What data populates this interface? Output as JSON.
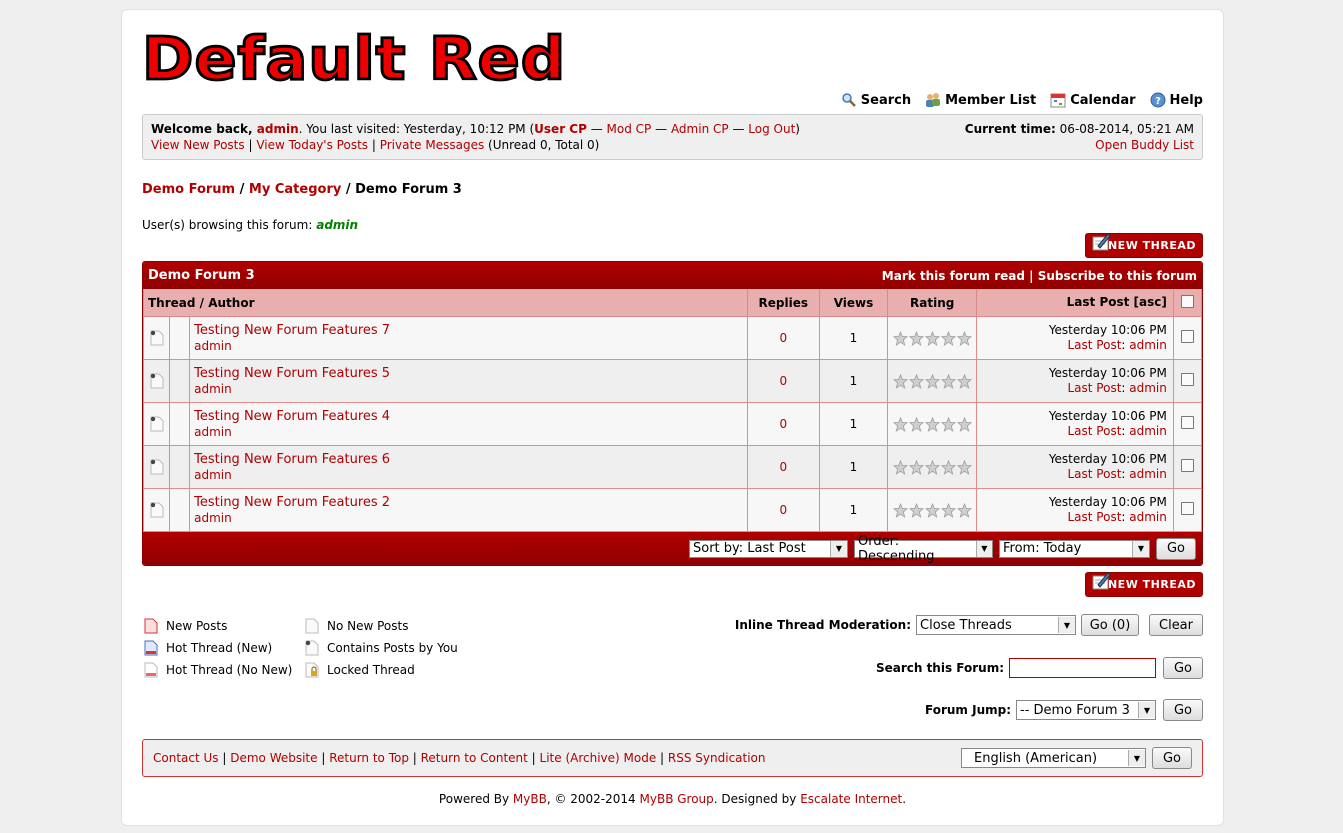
{
  "logo": {
    "text": "Default Red"
  },
  "menu": [
    {
      "label": "Search",
      "icon": "search-icon"
    },
    {
      "label": "Member List",
      "icon": "members-icon"
    },
    {
      "label": "Calendar",
      "icon": "calendar-icon"
    },
    {
      "label": "Help",
      "icon": "help-icon"
    }
  ],
  "welcome": {
    "prefix": "Welcome back, ",
    "user": "admin",
    "visited": ". You last visited: Yesterday, 10:12 PM (",
    "user_cp": "User CP",
    "mod_cp": "Mod CP",
    "admin_cp": "Admin CP",
    "logout": "Log Out",
    "sep": " — ",
    "close": ")",
    "view_new": "View New Posts",
    "view_today": "View Today's Posts",
    "pm": "Private Messages",
    "pm_counts": " (Unread 0, Total 0)",
    "time_label": "Current time:",
    "time_value": " 06-08-2014, 05:21 AM",
    "buddy": "Open Buddy List"
  },
  "breadcrumb": {
    "forum": "Demo Forum",
    "category": "My Category",
    "current": "Demo Forum 3",
    "sep": " / "
  },
  "browsing": {
    "label": "User(s) browsing this forum: ",
    "user": "admin"
  },
  "new_thread_label": "NEW THREAD",
  "table": {
    "title": "Demo Forum 3",
    "mark_read": "Mark this forum read",
    "subscribe": "Subscribe to this forum",
    "col_thread": "Thread / Author",
    "col_replies": "Replies",
    "col_views": "Views",
    "col_rating": "Rating",
    "col_lastpost": "Last Post [asc]",
    "lastpost_label": "Last Post",
    "rows": [
      {
        "title": "Testing New Forum Features 7",
        "author": "admin",
        "replies": "0",
        "views": "1",
        "date": "Yesterday 10:06 PM",
        "last_by": "admin"
      },
      {
        "title": "Testing New Forum Features 5",
        "author": "admin",
        "replies": "0",
        "views": "1",
        "date": "Yesterday 10:06 PM",
        "last_by": "admin"
      },
      {
        "title": "Testing New Forum Features 4",
        "author": "admin",
        "replies": "0",
        "views": "1",
        "date": "Yesterday 10:06 PM",
        "last_by": "admin"
      },
      {
        "title": "Testing New Forum Features 6",
        "author": "admin",
        "replies": "0",
        "views": "1",
        "date": "Yesterday 10:06 PM",
        "last_by": "admin"
      },
      {
        "title": "Testing New Forum Features 2",
        "author": "admin",
        "replies": "0",
        "views": "1",
        "date": "Yesterday 10:06 PM",
        "last_by": "admin"
      }
    ],
    "sort_by": "Sort by: Last Post",
    "order": "Order: Descending",
    "from": "From: Today",
    "go": "Go"
  },
  "legend": {
    "new_posts": "New Posts",
    "hot_new": "Hot Thread (New)",
    "hot_no_new": "Hot Thread (No New)",
    "no_new": "No New Posts",
    "contains_you": "Contains Posts by You",
    "locked": "Locked Thread"
  },
  "moderation": {
    "label": "Inline Thread Moderation:",
    "selected": "Close Threads",
    "go": "Go (0)",
    "clear": "Clear"
  },
  "search_forum": {
    "label": "Search this Forum:",
    "value": "",
    "go": "Go"
  },
  "forum_jump": {
    "label": "Forum Jump:",
    "selected": "-- Demo Forum 3",
    "go": "Go"
  },
  "footer": {
    "links": [
      "Contact Us",
      "Demo Website",
      "Return to Top",
      "Return to Content",
      "Lite (Archive) Mode",
      "RSS Syndication"
    ],
    "language": "English (American)",
    "go": "Go"
  },
  "powered": {
    "prefix": "Powered By ",
    "mybb": "MyBB",
    "mid": ", © 2002-2014 ",
    "group": "MyBB Group",
    "designed": ". Designed by ",
    "designer": "Escalate Internet",
    "end": "."
  },
  "colors": {
    "accent": "#b00000",
    "header": "#9e0000",
    "tcat": "#e9aeae"
  }
}
